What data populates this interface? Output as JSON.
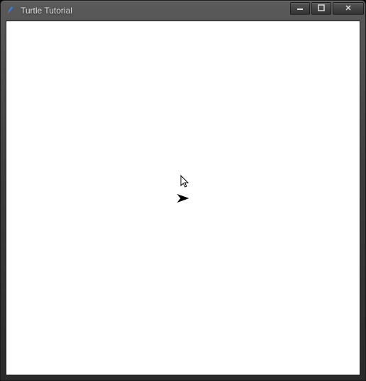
{
  "window": {
    "title": "Turtle Tutorial",
    "icon": "tk-feather-icon"
  },
  "controls": {
    "minimize": "minimize-icon",
    "maximize": "maximize-icon",
    "close": "close-icon"
  },
  "canvas": {
    "turtle": {
      "heading": 0,
      "shape": "classic",
      "color": "#000000"
    }
  }
}
